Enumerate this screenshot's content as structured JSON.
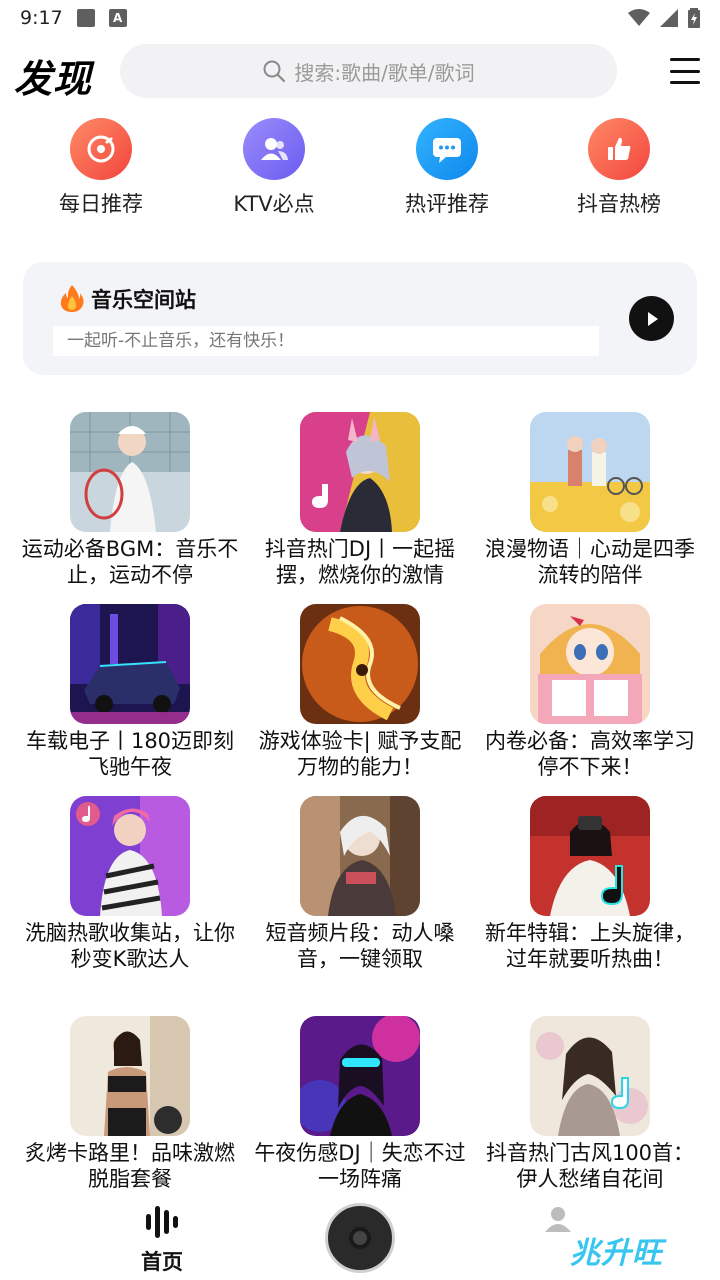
{
  "status_bar": {
    "time": "9:17"
  },
  "header": {
    "title": "发现",
    "search_placeholder": "搜索:歌曲/歌单/歌词"
  },
  "quick_links": [
    {
      "label": "每日推荐",
      "icon": "disc-icon",
      "color": "#f75c4a"
    },
    {
      "label": "KTV必点",
      "icon": "users-icon",
      "color": "#7b6cf6"
    },
    {
      "label": "热评推荐",
      "icon": "comment-icon",
      "color": "#1e9bf5"
    },
    {
      "label": "抖音热榜",
      "icon": "thumbs-up-icon",
      "color": "#f5614c"
    }
  ],
  "station": {
    "title": "音乐空间站",
    "subtitle": "一起听-不止音乐，还有快乐！"
  },
  "playlists": [
    {
      "title": "运动必备BGM：音乐不止，运动不停"
    },
    {
      "title": "抖音热门DJ丨一起摇摆，燃烧你的激情"
    },
    {
      "title": "浪漫物语｜心动是四季流转的陪伴"
    },
    {
      "title": "车载电子丨180迈即刻飞驰午夜"
    },
    {
      "title": "游戏体验卡| 赋予支配万物的能力！"
    },
    {
      "title": "内卷必备：高效率学习停不下来！"
    },
    {
      "title": "洗脑热歌收集站，让你秒变K歌达人"
    },
    {
      "title": "短音频片段：动人嗓音，一键领取"
    },
    {
      "title": "新年特辑：上头旋律，过年就要听热曲！"
    },
    {
      "title": "炙烤卡路里！品味激燃脱脂套餐"
    },
    {
      "title": "午夜伤感DJ｜失恋不过一场阵痛"
    },
    {
      "title": "抖音热门古风100首：伊人愁绪自花间"
    }
  ],
  "bottom_nav": {
    "home_label": "首页",
    "watermark": "兆升旺"
  }
}
